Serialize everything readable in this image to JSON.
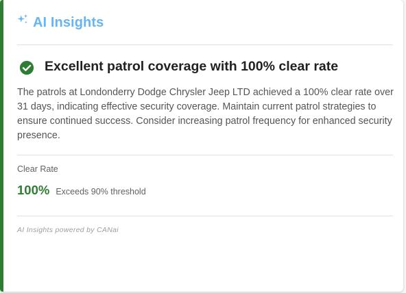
{
  "header": {
    "title": "AI Insights",
    "icon": "sparkle-icon",
    "color": "#64b5f6"
  },
  "insight": {
    "status_icon": "check-circle-icon",
    "headline": "Excellent patrol coverage with 100% clear rate",
    "summary": "The patrols at Londonderry Dodge Chrysler Jeep LTD achieved a 100% clear rate over 31 days, indicating effective security coverage. Maintain current patrol strategies to ensure continued success. Consider increasing patrol frequency for enhanced security presence."
  },
  "metric": {
    "label": "Clear Rate",
    "value": "100%",
    "note": "Exceeds 90% threshold",
    "color": "#2e7d32"
  },
  "footer": {
    "text": "AI Insights powered by CANai"
  },
  "accent_color": "#2e7d32"
}
